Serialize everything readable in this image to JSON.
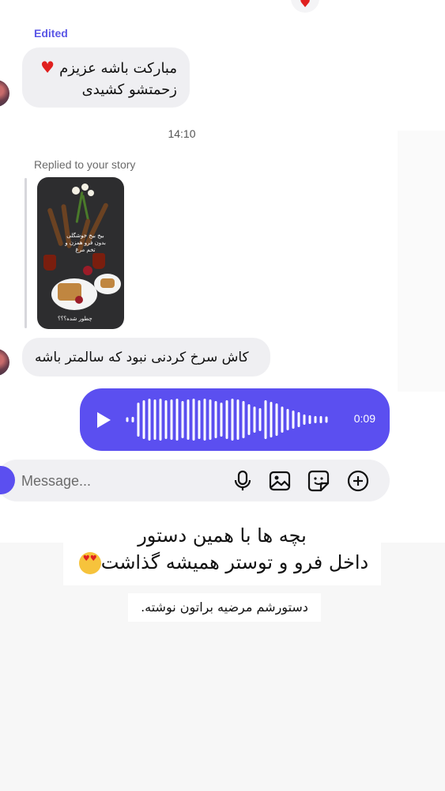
{
  "top_reaction": {
    "icon": "heart-icon",
    "glyph": "♥"
  },
  "edited_label": "Edited",
  "messages": [
    {
      "line1": "مبارکت باشه عزیزم",
      "line2": "زحمتشو کشیدی",
      "reaction_glyph": "♥"
    },
    {
      "text": "کاش سرخ کردنی نبود که سالمتر باشه"
    }
  ],
  "timestamp": "14:10",
  "story_reply": {
    "label": "Replied to your story",
    "caption": "بیخ بیخ خوشگلی بدون فرو همزن و تخم مرغ",
    "bottom_text": "چطور شده؟؟؟"
  },
  "voice_message": {
    "duration": "0:09",
    "play_icon": "play-icon"
  },
  "composer": {
    "placeholder": "Message...",
    "icons": [
      "camera-icon",
      "microphone-icon",
      "image-gallery-icon",
      "sticker-icon",
      "add-icon"
    ]
  },
  "overlay": {
    "line1": "بچه ها  با همین دستور",
    "line2": "داخل فرو و توستر همیشه گذاشت",
    "note": "دستورشم مرضیه براتون نوشته."
  },
  "colors": {
    "accent": "#5b4ff0",
    "bubble": "#efeff2",
    "heart": "#e0201f",
    "edited": "#5b57e6"
  }
}
